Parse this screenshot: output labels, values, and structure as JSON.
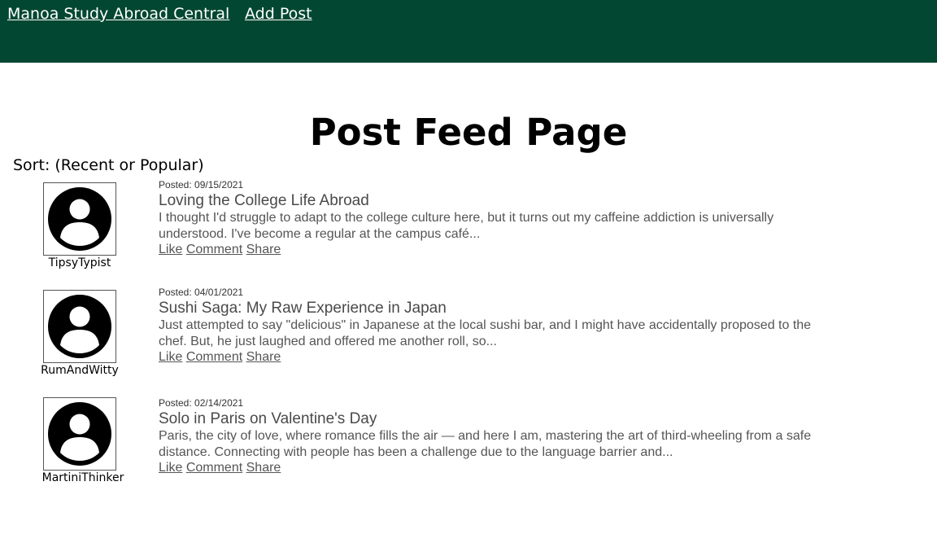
{
  "nav": {
    "brand": "Manoa Study Abroad Central",
    "add_post": "Add Post"
  },
  "page_title": "Post Feed Page",
  "sort_label": "Sort: (Recent or Popular)",
  "icons": {
    "avatar": "user-avatar-icon"
  },
  "colors": {
    "navbar": "#024731",
    "nav_text": "#ffffff"
  },
  "posts": [
    {
      "username": "TipsyTypist",
      "posted": "Posted: 09/15/2021",
      "title": "Loving the College Life Abroad",
      "excerpt": "I thought I'd struggle to adapt to the college culture here, but it turns out my caffeine addiction is universally understood. I've become a regular at the campus café...",
      "like": "Like",
      "comment": "Comment",
      "share": "Share"
    },
    {
      "username": "RumAndWitty",
      "posted": "Posted: 04/01/2021",
      "title": "Sushi Saga: My Raw Experience in Japan",
      "excerpt": "Just attempted to say \"delicious\" in Japanese at the local sushi bar, and I might have accidentally proposed to the chef. But, he just laughed and offered me another roll, so...",
      "like": "Like",
      "comment": "Comment",
      "share": "Share"
    },
    {
      "username": "MartiniThinker",
      "posted": "Posted: 02/14/2021",
      "title": "Solo in Paris on Valentine's Day",
      "excerpt": "Paris, the city of love, where romance fills the air — and here I am, mastering the art of third-wheeling from a safe distance. Connecting with people has been a challenge due to the language barrier and...",
      "like": "Like",
      "comment": "Comment",
      "share": "Share"
    }
  ]
}
